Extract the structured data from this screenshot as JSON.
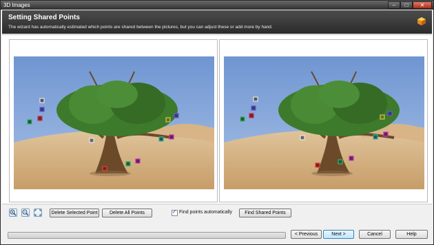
{
  "window": {
    "title": "3D Images",
    "controls": [
      "–",
      "□",
      "✕"
    ]
  },
  "banner": {
    "title": "Setting Shared Points",
    "description": "The wizard has automatically estimated which points are shared between the pictures, but you can adjust these or add more by hand."
  },
  "toolbar": {
    "zoom_in_icon": "zoom-in-icon",
    "zoom_out_icon": "zoom-out-icon",
    "fit_icon": "fit-to-window-icon",
    "delete_selected": "Delete Selected Point",
    "delete_all": "Delete All Points",
    "find_auto_label": "Find points automatically",
    "find_auto_checked": true,
    "find_shared": "Find Shared Points"
  },
  "footer": {
    "progress": 0,
    "previous": "< Previous",
    "next": "Next >",
    "cancel": "Cancel",
    "help": "Help"
  },
  "colors": {
    "banner": "#2b2b2b",
    "accent": "#3c7fb1",
    "sky": "#8fb0df",
    "sand": "#d7b68a",
    "foliage": "#3d7a2c"
  }
}
